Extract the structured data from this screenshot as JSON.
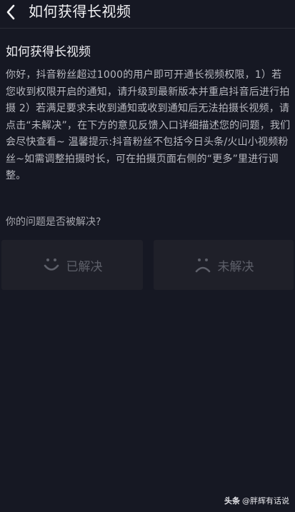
{
  "header": {
    "title": "如何获得长视频",
    "back_icon": "chevron-left-icon"
  },
  "article": {
    "title": "如何获得长视频",
    "body": "你好，抖音粉丝超过1000的用户即可开通长视频权限，1）若您收到权限开启的通知，请升级到最新版本并重启抖音后进行拍摄 2）若满足要求未收到通知或收到通知后无法拍摄长视频，请点击“未解决”，在下方的意见反馈入口详细描述您的问题，我们会尽快查看~ 温馨提示:抖音粉丝不包括今日头条/火山小视频粉丝~如需调整拍摄时长，可在拍摄页面右侧的“更多”里进行调整。"
  },
  "feedback": {
    "question": "你的问题是否被解决?",
    "solved": {
      "label": "已解决",
      "icon": "smile-icon"
    },
    "unsolved": {
      "label": "未解决",
      "icon": "frown-icon"
    }
  },
  "watermark": {
    "logo": "头条",
    "text": "@胖辉有话说"
  },
  "colors": {
    "background": "#161823",
    "button_bg": "#1f2029",
    "muted": "#5e606a"
  }
}
